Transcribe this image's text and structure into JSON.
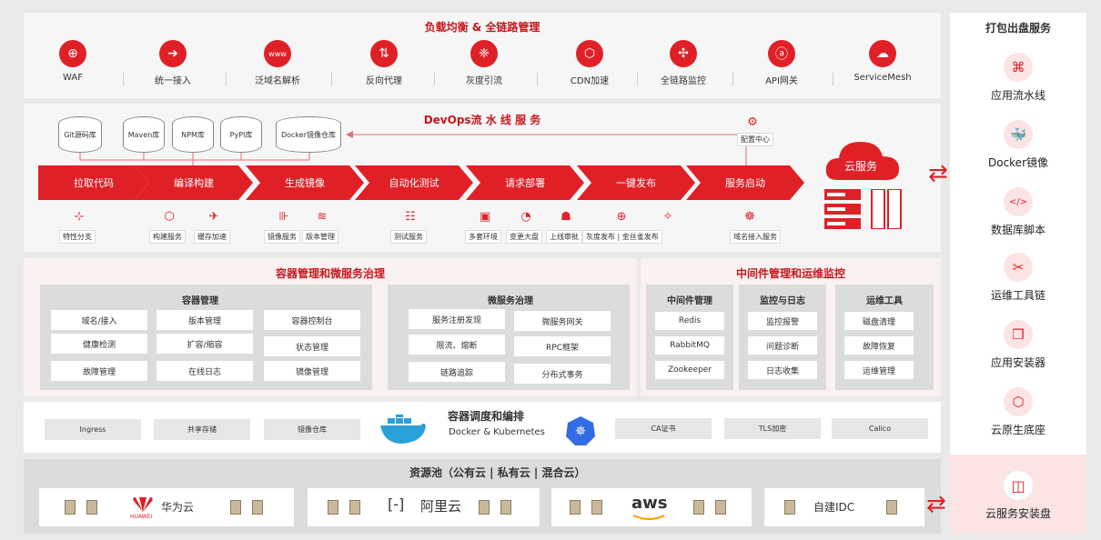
{
  "top": {
    "title": "负载均衡 & 全链路管理",
    "items": [
      {
        "label": "WAF",
        "icon": "waf-icon"
      },
      {
        "label": "统一接入",
        "icon": "login-icon"
      },
      {
        "label": "泛域名解析",
        "icon": "www-icon"
      },
      {
        "label": "反向代理",
        "icon": "swap-icon"
      },
      {
        "label": "灰度引流",
        "icon": "flow-icon"
      },
      {
        "label": "CDN加速",
        "icon": "cdn-icon"
      },
      {
        "label": "全链路监控",
        "icon": "network-icon"
      },
      {
        "label": "API网关",
        "icon": "api-icon"
      },
      {
        "label": "ServiceMesh",
        "icon": "mesh-icon"
      }
    ]
  },
  "devops": {
    "title": "DevOps流 水 线 服 务",
    "repos": [
      "Git源码库",
      "Maven库",
      "NPM库",
      "PyPI库",
      "Docker镜像仓库"
    ],
    "config": "配置中心",
    "steps": [
      "拉取代码",
      "编译构建",
      "生成镜像",
      "自动化测试",
      "请求部署",
      "一键发布",
      "服务启动"
    ],
    "subs": [
      "特性分支",
      "构建服务",
      "缓存加速",
      "镜像服务",
      "版本管理",
      "测试服务",
      "多套环境",
      "变更大盘",
      "上线审批",
      "灰度发布 | 金丝雀发布",
      "域名接入服务"
    ],
    "cloud": "云服务"
  },
  "container": {
    "title": "容器管理和微服务治理",
    "mgmt_title": "容器管理",
    "mgmt": [
      "域名/接入",
      "版本管理",
      "容器控制台",
      "健康检测",
      "扩容/缩容",
      "状态管理",
      "故障管理",
      "在线日志",
      "镜像管理"
    ],
    "ms_title": "微服务治理",
    "ms": [
      "服务注册发现",
      "微服务网关",
      "限流、熔断",
      "RPC框架",
      "链路追踪",
      "分布式事务"
    ]
  },
  "middleware": {
    "title": "中间件管理和运维监控",
    "cols": [
      {
        "title": "中间件管理",
        "items": [
          "Redis",
          "RabbitMQ",
          "Zookeeper"
        ]
      },
      {
        "title": "监控与日志",
        "items": [
          "监控报警",
          "问题诊断",
          "日志收集"
        ]
      },
      {
        "title": "运维工具",
        "items": [
          "磁盘清理",
          "故障恢复",
          "运维管理"
        ]
      }
    ]
  },
  "sched": {
    "title": "容器调度和编排",
    "subtitle": "Docker & Kubernetes",
    "left": [
      "Ingress",
      "共享存储",
      "镜像仓库"
    ],
    "right": [
      "CA证书",
      "TLS加密",
      "Calico"
    ]
  },
  "pool": {
    "title": "资源池（公有云 | 私有云 | 混合云）",
    "providers": [
      "华为云",
      "阿里云",
      "aws",
      "自建IDC"
    ],
    "huawei_sub": "HUAWEI"
  },
  "side": {
    "title": "打包出盘服务",
    "items": [
      "应用流水线",
      "Docker镜像",
      "数据库脚本",
      "运维工具链",
      "应用安装器",
      "云原生底座"
    ],
    "disk": "云服务安装盘"
  },
  "colors": {
    "accent": "#e02027"
  }
}
